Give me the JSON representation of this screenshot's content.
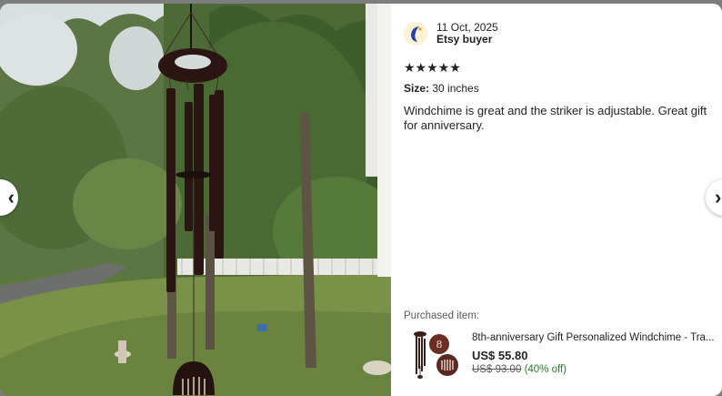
{
  "review": {
    "date": "11 Oct, 2025",
    "reviewer": "Etsy buyer",
    "stars": "★★★★★",
    "rating": 5,
    "size_label": "Size:",
    "size_value": "30 inches",
    "text": "Windchime is great and the striker is adjustable. Great gift for anniversary."
  },
  "purchased": {
    "label": "Purchased item:",
    "title": "8th-anniversary Gift Personalized Windchime - Tra...",
    "price": "US$ 55.80",
    "original_price": "US$ 93.00",
    "discount": "(40% off)"
  },
  "nav": {
    "prev_icon": "‹",
    "next_icon": "›"
  },
  "colors": {
    "windchime": "#2a1512",
    "discount_green": "#2b7a2b",
    "avatar_blue": "#2540a8"
  }
}
